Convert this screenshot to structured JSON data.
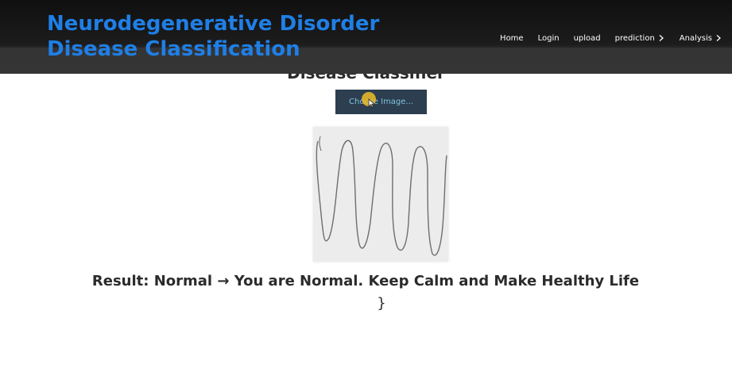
{
  "header": {
    "title": "Neurodegenerative Disorder Disease Classification",
    "nav": [
      {
        "label": "Home",
        "has_chevron": false
      },
      {
        "label": "Login",
        "has_chevron": false
      },
      {
        "label": "upload",
        "has_chevron": false
      },
      {
        "label": "prediction",
        "has_chevron": true
      },
      {
        "label": "Analysis",
        "has_chevron": true
      }
    ]
  },
  "main": {
    "heading": "Disease Classifier",
    "choose_button_label": "Choose Image...",
    "preview_alt": "uploaded spiral drawing",
    "result_text": "Result: Normal → You are Normal. Keep Calm and Make Healthy Life",
    "trailing_text": "}"
  },
  "colors": {
    "title": "#1f7fe6",
    "button_bg": "#2c3e50",
    "button_text": "#7fc3df"
  }
}
